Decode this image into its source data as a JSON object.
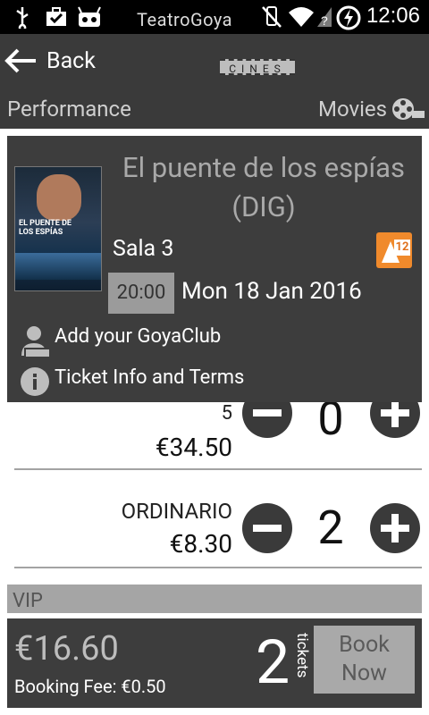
{
  "status_bar": {
    "time": "12:06"
  },
  "action_bar": {
    "back_label": "Back",
    "logo_top": "TeatroGoya",
    "logo_bottom": "CINES"
  },
  "tabs": {
    "performance": "Performance",
    "movies": "Movies"
  },
  "movie": {
    "poster_title": "EL PUENTE DE LOS ESPÍAS",
    "title": "El puente de los espías (DIG)",
    "sala": "Sala 3",
    "rating": "12",
    "time": "20:00",
    "date": "Mon 18 Jan 2016",
    "goyaclub_label": "Add your GoyaClub",
    "ticket_info_label": "Ticket Info and Terms"
  },
  "tickets": [
    {
      "name": "5",
      "price": "€34.50",
      "qty": "0"
    },
    {
      "name": "ORDINARIO",
      "price": "€8.30",
      "qty": "2"
    }
  ],
  "vip_header": "VIP",
  "booking": {
    "total": "€16.60",
    "fee": "Booking Fee: €0.50",
    "ticket_count": "2",
    "tickets_label": "tickets",
    "book_line1": "Book",
    "book_line2": "Now"
  }
}
